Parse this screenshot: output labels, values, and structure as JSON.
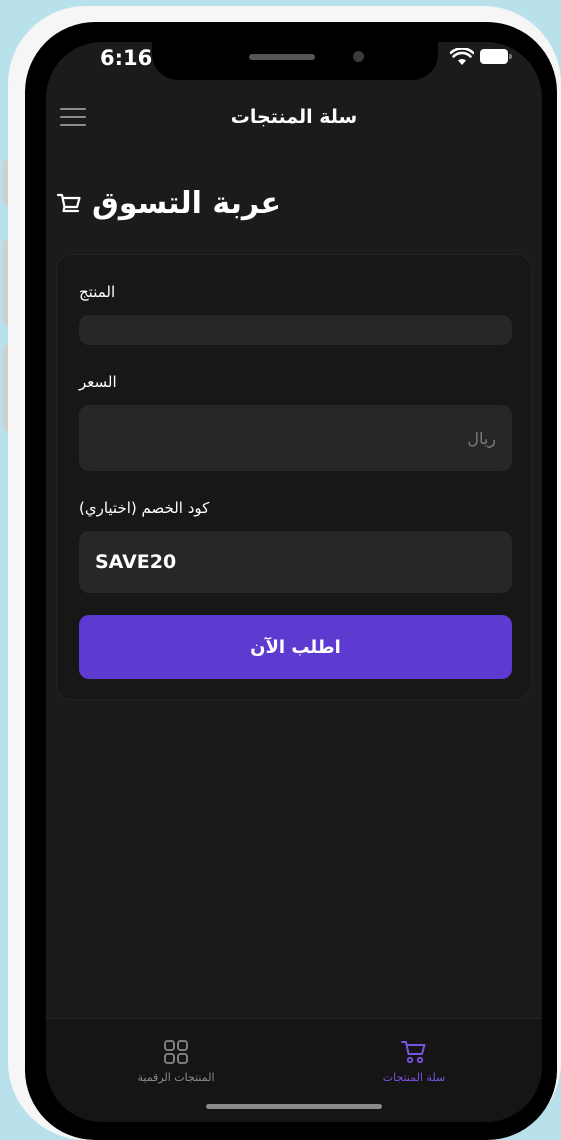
{
  "status_bar": {
    "time": "6:16"
  },
  "header": {
    "title": "سلة المنتجات"
  },
  "page": {
    "title": "عربة التسوق"
  },
  "form": {
    "product_label": "المنتج",
    "product_value": "",
    "price_label": "السعر",
    "price_placeholder": "ريال",
    "discount_label": "كود الخصم (اختياري)",
    "discount_value": "SAVE20",
    "submit_label": "اطلب الآن"
  },
  "bottom_nav": {
    "items": [
      {
        "label": "المنتجات الرقمية",
        "icon": "grid-icon",
        "active": false
      },
      {
        "label": "سلة المنتجات",
        "icon": "cart-icon",
        "active": true
      }
    ]
  },
  "colors": {
    "background": "#b9e1ec",
    "screen": "#1b1b1d",
    "accent": "#5e3bd0",
    "active_nav": "#7a52e0"
  }
}
